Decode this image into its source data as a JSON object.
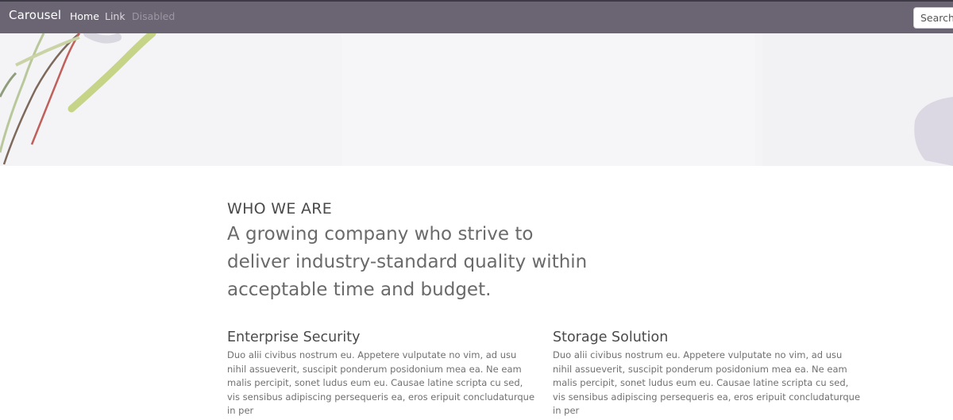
{
  "navbar": {
    "brand": "Carousel",
    "links": [
      {
        "label": "Home",
        "state": "active"
      },
      {
        "label": "Link",
        "state": "normal"
      },
      {
        "label": "Disabled",
        "state": "disabled"
      }
    ],
    "search_placeholder": "Search"
  },
  "hero": {
    "image_description": "faded plant stems"
  },
  "intro": {
    "heading": "WHO WE ARE",
    "lead": "A growing company who strive to deliver industry-standard quality within acceptable time and budget."
  },
  "features": [
    {
      "title": "Enterprise Security",
      "text": "Duo alii civibus nostrum eu. Appetere vulputate no vim, ad usu nihil assueverit, suscipit ponderum posidonium mea ea. Ne eam malis percipit, sonet ludus eum eu. Causae latine scripta cu sed, vis sensibus adipiscing persequeris ea, eros eripuit concludaturque in per"
    },
    {
      "title": "Storage Solution",
      "text": "Duo alii civibus nostrum eu. Appetere vulputate no vim, ad usu nihil assueverit, suscipit ponderum posidonium mea ea. Ne eam malis percipit, sonet ludus eum eu. Causae latine scripta cu sed, vis sensibus adipiscing persequeris ea, eros eripuit concludaturque in per"
    }
  ],
  "colors": {
    "navbar_bg": "#6b6573",
    "hero_bg": "#f4f3f6"
  }
}
